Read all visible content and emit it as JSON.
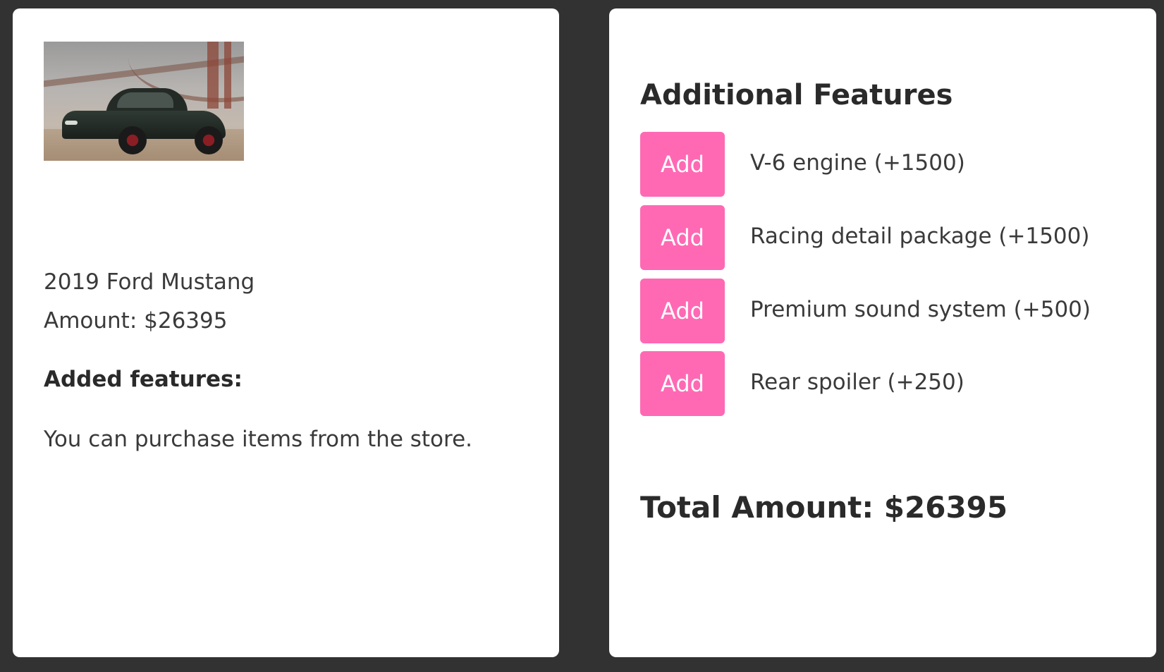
{
  "car": {
    "image_alt": "2019 Ford Mustang",
    "name": "2019 Ford Mustang",
    "amount_label": "Amount: $26395"
  },
  "added_features": {
    "heading": "Added features:",
    "empty_message": "You can purchase items from the store."
  },
  "store": {
    "title": "Additional Features",
    "features": [
      {
        "button_label": "Add",
        "label": "V-6 engine (+1500)"
      },
      {
        "button_label": "Add",
        "label": "Racing detail package (+1500)"
      },
      {
        "button_label": "Add",
        "label": "Premium sound system (+500)"
      },
      {
        "button_label": "Add",
        "label": "Rear spoiler (+250)"
      }
    ]
  },
  "total": {
    "label": "Total Amount: $26395"
  },
  "colors": {
    "background": "#323232",
    "card": "#ffffff",
    "accent_button": "#ff69b4"
  }
}
